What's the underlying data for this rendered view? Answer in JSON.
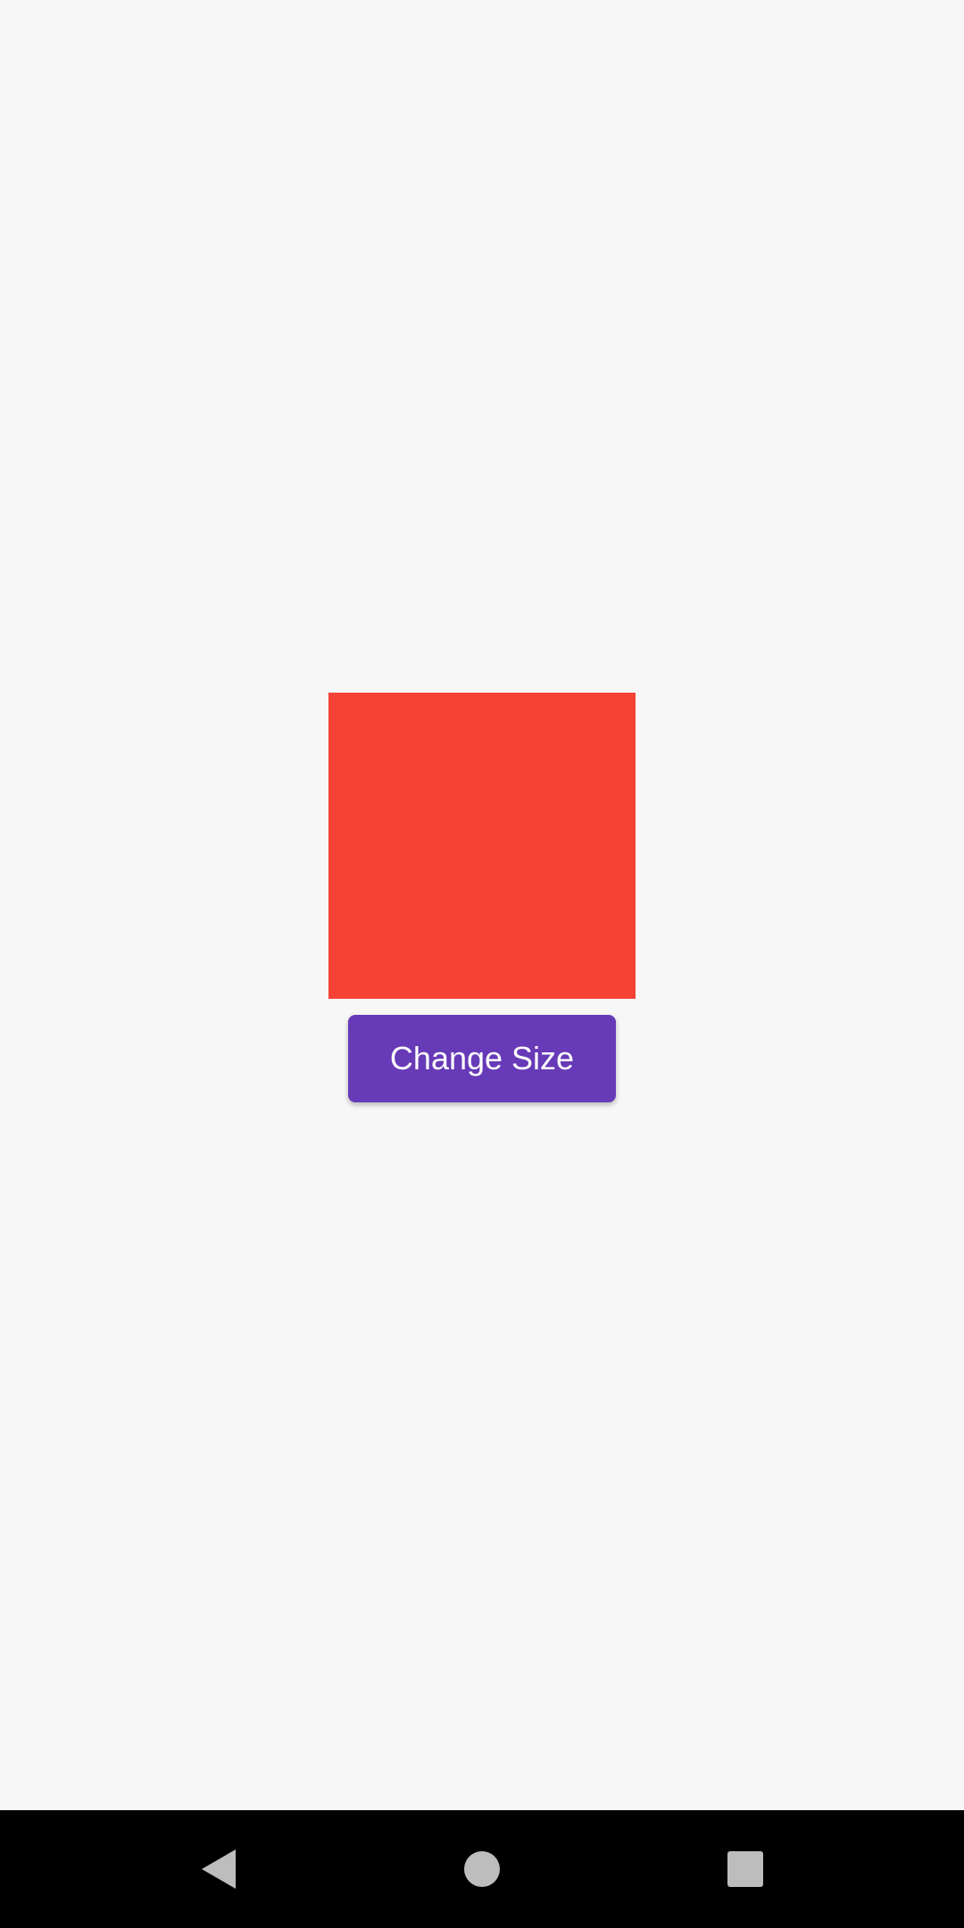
{
  "button": {
    "label": "Change Size"
  },
  "colors": {
    "background": "#f7f7f7",
    "box": "#f44336",
    "button": "#673ab7",
    "button_text": "#ffffff",
    "nav_bar": "#000000",
    "nav_icons": "#bdbdbd"
  },
  "nav": {
    "icons": [
      "back-icon",
      "home-icon",
      "recents-icon"
    ]
  }
}
